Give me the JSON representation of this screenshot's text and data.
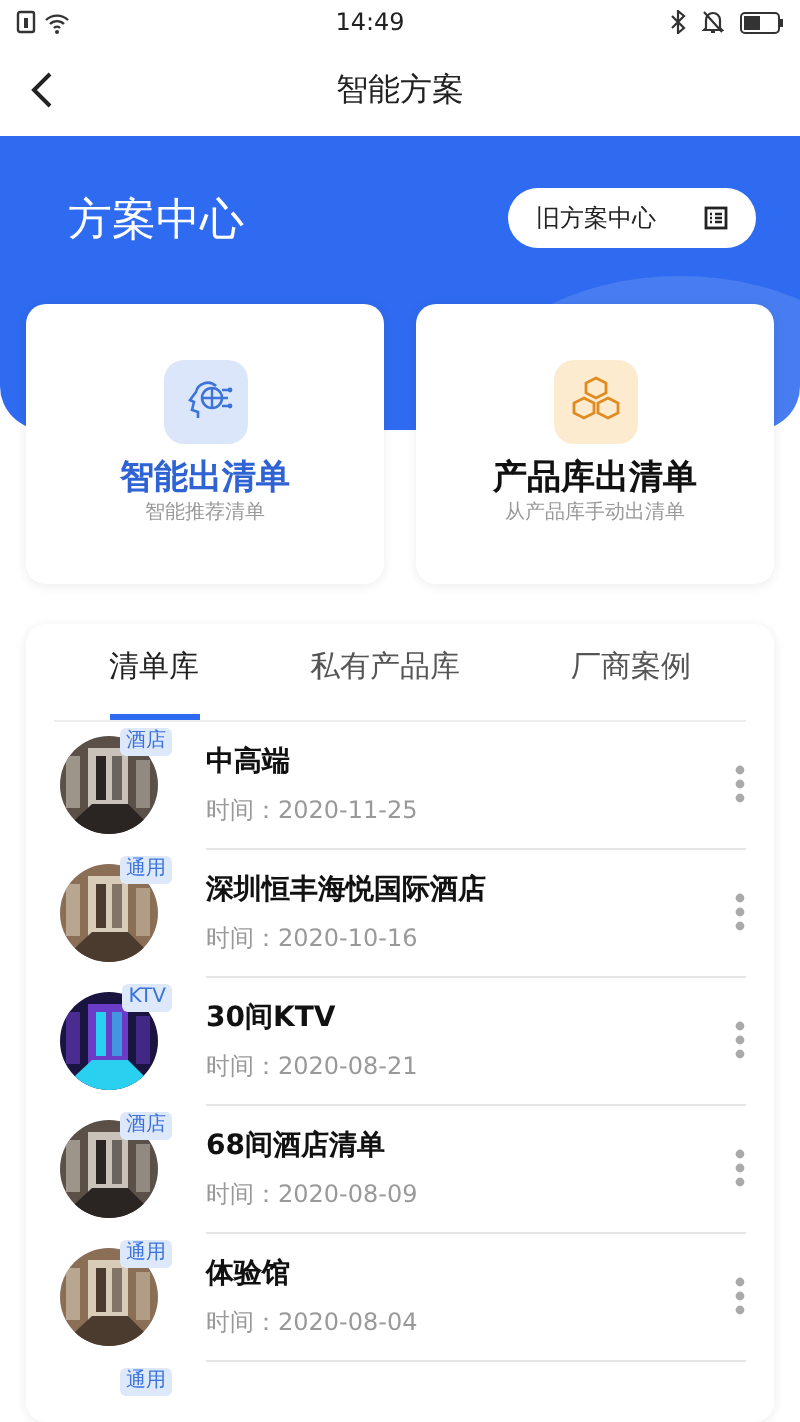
{
  "status_bar": {
    "time": "14:49"
  },
  "header": {
    "title": "智能方案"
  },
  "banner": {
    "title": "方案中心",
    "button": "旧方案中心"
  },
  "cards": [
    {
      "kind": "ai",
      "title": "智能出清单",
      "subtitle": "智能推荐清单",
      "selected": true
    },
    {
      "kind": "cubes",
      "title": "产品库出清单",
      "subtitle": "从产品库手动出清单",
      "selected": false
    }
  ],
  "tabs": [
    {
      "label": "清单库",
      "selected": true
    },
    {
      "label": "私有产品库",
      "selected": false
    },
    {
      "label": "厂商案例",
      "selected": false
    }
  ],
  "rows": [
    {
      "tag": "酒店",
      "title": "中高端",
      "time": "时间：2020-11-25",
      "kind": "picture"
    },
    {
      "tag": "通用",
      "title": "深圳恒丰海悦国际酒店",
      "time": "时间：2020-10-16",
      "kind": "picture"
    },
    {
      "tag": "KTV",
      "title": "30间KTV",
      "time": "时间：2020-08-21",
      "kind": "picture"
    },
    {
      "tag": "酒店",
      "title": "68间酒店清单",
      "time": "时间：2020-08-09",
      "kind": "picture"
    },
    {
      "tag": "通用",
      "title": "体验馆",
      "time": "时间：2020-08-04",
      "kind": "picture"
    },
    {
      "tag": "通用"
    }
  ]
}
